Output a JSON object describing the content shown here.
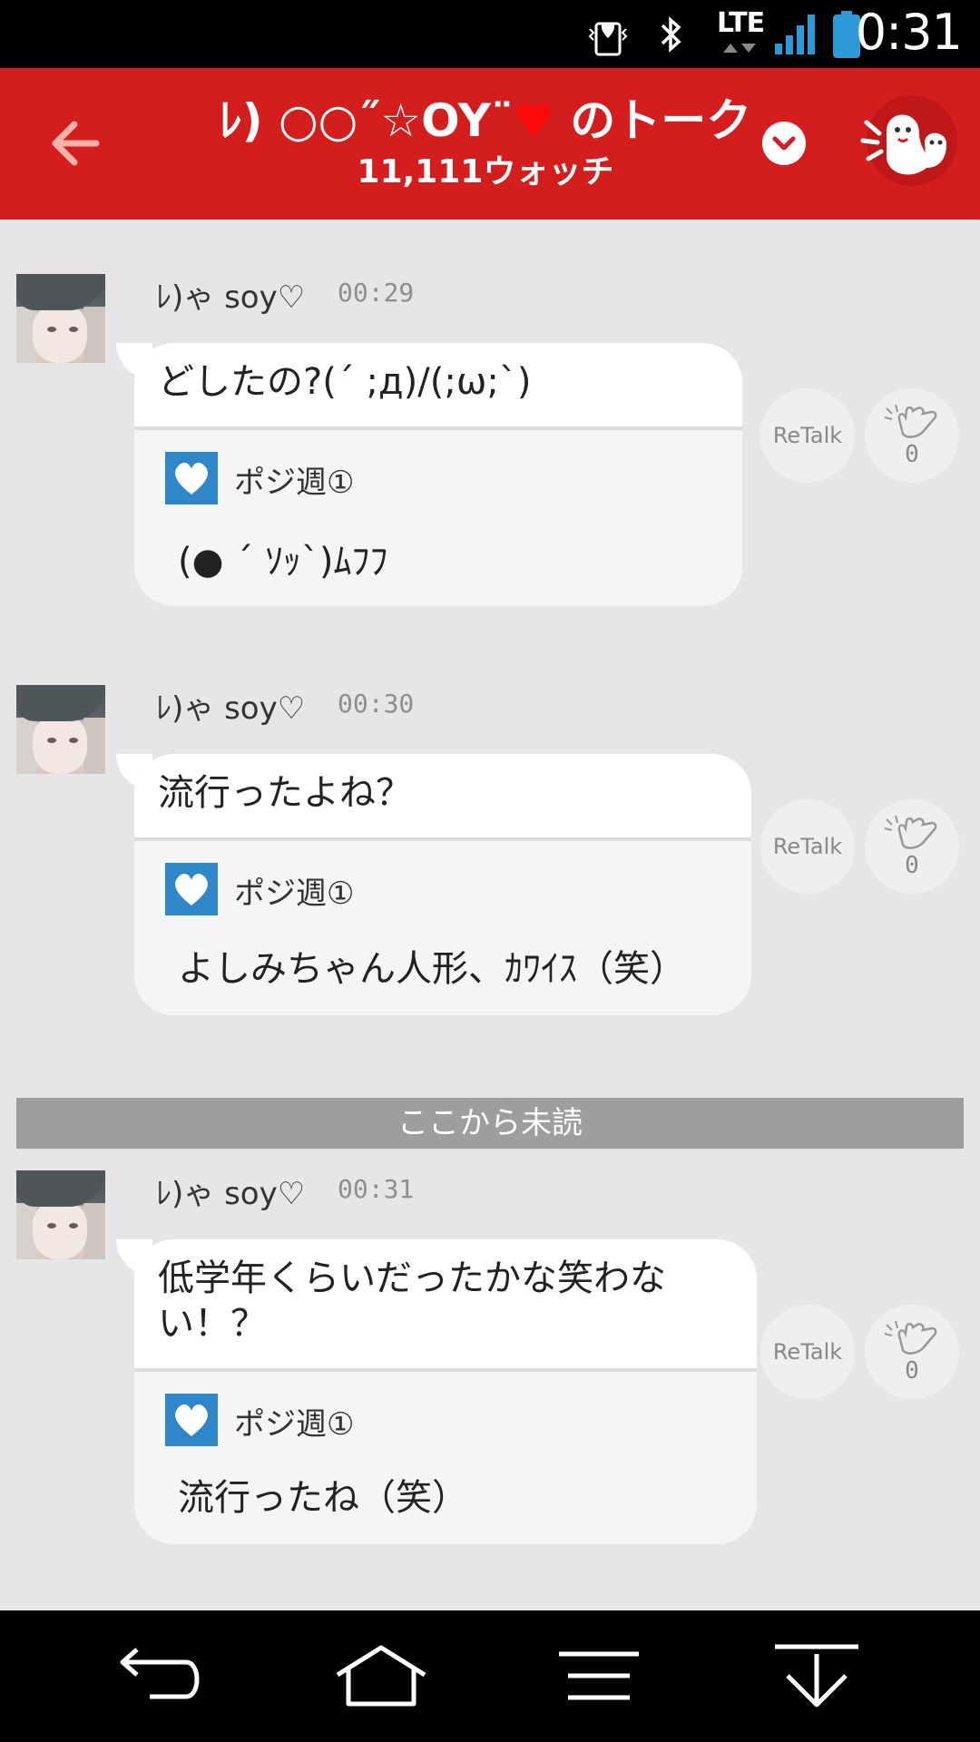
{
  "status_bar": {
    "time": "0:31",
    "network": "LTE",
    "icons": [
      "vibrate-heart-icon",
      "bluetooth-icon",
      "lte-arrows-icon",
      "signal-icon",
      "battery-icon"
    ]
  },
  "header": {
    "title_prefix": "ﾚ) ○○˝☆OY¨",
    "title_heart": "♥",
    "title_suffix": " のトーク",
    "subtitle": "11,111ウォッチ",
    "color": "#d41e1e"
  },
  "messages": [
    {
      "sender": "ﾚ)ゃ soy♡",
      "time": "00:29",
      "text": "どしたの?(´ ;д)/(;ω;`)",
      "quote_name": "ポジ週①",
      "quote_text": "(● ´ ｿｯ`)ﾑﾌﾌ",
      "retalk": "ReTalk",
      "claps": "0"
    },
    {
      "sender": "ﾚ)ゃ soy♡",
      "time": "00:30",
      "text": "流行ったよね？",
      "quote_name": "ポジ週①",
      "quote_text": "よしみちゃん人形、ｶﾜｲｽ（笑）",
      "retalk": "ReTalk",
      "claps": "0"
    },
    {
      "sender": "ﾚ)ゃ soy♡",
      "time": "00:31",
      "text_line1": "低学年くらいだったかな笑わな",
      "text_line2": "い！？",
      "quote_name": "ポジ週①",
      "quote_text": "流行ったね（笑）",
      "retalk": "ReTalk",
      "claps": "0"
    }
  ],
  "unread_label": "ここから未読",
  "nav": [
    "back-icon",
    "home-icon",
    "menu-icon",
    "scroll-down-icon"
  ]
}
